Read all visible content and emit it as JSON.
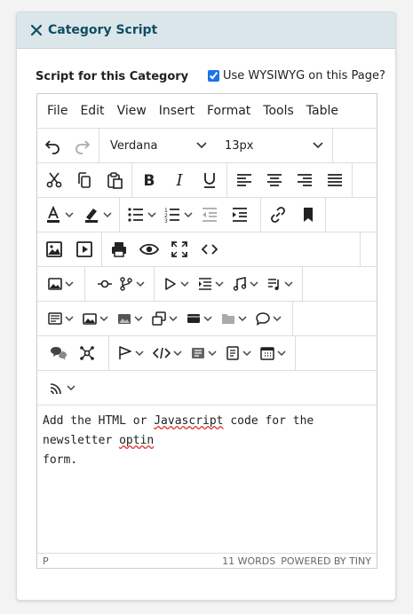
{
  "panel": {
    "title": "Category Script"
  },
  "form": {
    "label": "Script for this Category",
    "wysiwyg_label": "Use WYSIWYG on this Page?",
    "wysiwyg_checked": true
  },
  "menubar": [
    "File",
    "Edit",
    "View",
    "Insert",
    "Format",
    "Tools",
    "Table"
  ],
  "toolbar": {
    "font_family": "Verdana",
    "font_size": "13px"
  },
  "icons": [
    "undo-icon",
    "redo-icon",
    "cut-icon",
    "copy-icon",
    "paste-icon",
    "bold-icon",
    "italic-icon",
    "underline-icon",
    "align-left-icon",
    "align-center-icon",
    "align-right-icon",
    "align-justify-icon",
    "text-color-icon",
    "highlight-icon",
    "bullet-list-icon",
    "numbered-list-icon",
    "outdent-icon",
    "indent-icon",
    "link-icon",
    "bookmark-icon",
    "image-icon",
    "media-icon",
    "print-icon",
    "preview-icon",
    "fullscreen-icon",
    "code-icon",
    "gallery-icon",
    "horizontal-rule-icon",
    "branch-icon",
    "play-icon",
    "template-icon",
    "music-icon",
    "playlist-icon",
    "card-icon",
    "images-icon",
    "image-gallery-icon",
    "layers-icon",
    "banner-icon",
    "folder-icon",
    "comment-icon",
    "comments-icon",
    "hub-icon",
    "flag-icon",
    "code-embed-icon",
    "list-block-icon",
    "document-icon",
    "calendar-icon",
    "rss-icon"
  ],
  "content": {
    "line1_a": "Add the HTML or ",
    "word1": "Javascript",
    "line1_b": " code for the newsletter ",
    "word2": "optin",
    "line2": "form."
  },
  "status": {
    "path": "P",
    "words": "11 WORDS",
    "powered": "POWERED BY TINY"
  },
  "colors": {
    "accent": "#0e4f63",
    "header_bg": "#dbe6ea"
  }
}
